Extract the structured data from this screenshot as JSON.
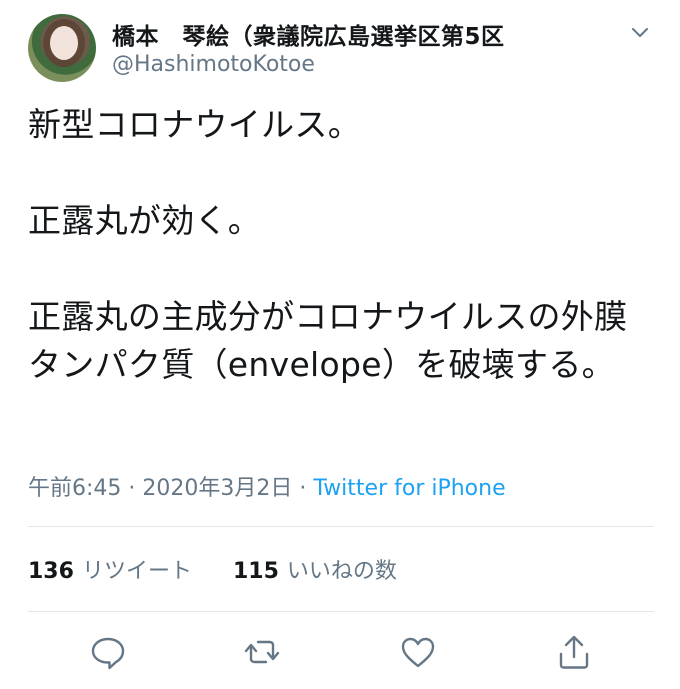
{
  "author": {
    "display_name": "橋本　琴絵（衆議院広島選挙区第5区",
    "handle": "@HashimotoKotoe"
  },
  "tweet": {
    "text": "新型コロナウイルス。\n\n正露丸が効く。\n\n正露丸の主成分がコロナウイルスの外膜タンパク質（envelope）を破壊する。",
    "time": "午前6:45",
    "separator": "·",
    "date": "2020年3月2日",
    "source": "Twitter for iPhone"
  },
  "stats": {
    "retweets_count": "136",
    "retweets_label": "リツイート",
    "likes_count": "115",
    "likes_label": "いいねの数"
  },
  "icons": [
    "chevron-down-icon",
    "reply-icon",
    "retweet-icon",
    "like-icon",
    "share-icon"
  ],
  "colors": {
    "text": "#14171a",
    "secondary": "#657786",
    "link": "#1da1f2",
    "divider": "#e1e8ed"
  }
}
